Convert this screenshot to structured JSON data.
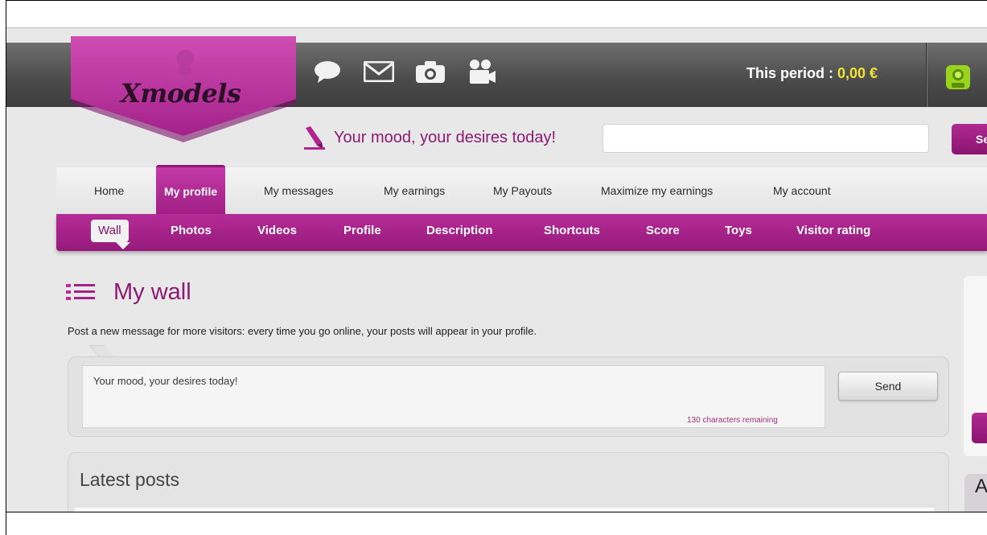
{
  "header": {
    "logo_text": "Xmodels",
    "icons": [
      "chat-icon",
      "mail-icon",
      "camera-icon",
      "video-camera-icon"
    ],
    "period_label": "This period : ",
    "period_amount": "0,00 €",
    "colors": {
      "brand": "#a01f86",
      "amount": "#f2e532",
      "bar": "#4a4a4a"
    }
  },
  "mood": {
    "label": "Your mood, your desires today!",
    "input_value": "",
    "button_label": "Se"
  },
  "main_nav": {
    "items": [
      {
        "label": "Home"
      },
      {
        "label": "My profile",
        "active": true
      },
      {
        "label": "My messages"
      },
      {
        "label": "My earnings"
      },
      {
        "label": "My Payouts"
      },
      {
        "label": "Maximize my earnings"
      },
      {
        "label": "My account"
      }
    ]
  },
  "sub_nav": {
    "items": [
      {
        "label": "Wall",
        "active": true
      },
      {
        "label": "Photos"
      },
      {
        "label": "Videos"
      },
      {
        "label": "Profile"
      },
      {
        "label": "Description"
      },
      {
        "label": "Shortcuts"
      },
      {
        "label": "Score"
      },
      {
        "label": "Toys"
      },
      {
        "label": "Visitor rating"
      }
    ]
  },
  "wall": {
    "title": "My wall",
    "description": "Post a new message for more visitors: every time you go online, your posts will appear in your profile.",
    "post_placeholder": "Your mood, your desires today!",
    "char_count": "130 characters remaining",
    "send_label": "Send"
  },
  "latest": {
    "title": "Latest posts"
  },
  "right_column": {
    "letter": "A"
  }
}
